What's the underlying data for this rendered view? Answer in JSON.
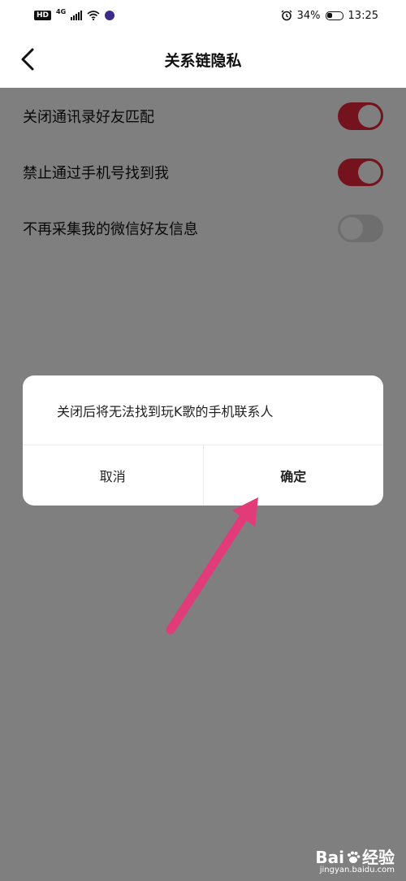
{
  "status_bar": {
    "hd": "HD",
    "network": "4G",
    "battery_pct": "34%",
    "time": "13:25",
    "icons": [
      "signal-icon",
      "wifi-icon",
      "app-icon",
      "alarm-icon",
      "battery-icon"
    ]
  },
  "nav": {
    "title": "关系链隐私",
    "back_icon": "chevron-left-icon"
  },
  "settings": [
    {
      "label": "关闭通讯录好友匹配",
      "enabled": true
    },
    {
      "label": "禁止通过手机号找到我",
      "enabled": true
    },
    {
      "label": "不再采集我的微信好友信息",
      "enabled": false
    }
  ],
  "dialog": {
    "message": "关闭后将无法找到玩K歌的手机联系人",
    "cancel_label": "取消",
    "confirm_label": "确定"
  },
  "annotation": {
    "arrow_color": "#e23b7a"
  },
  "watermark": {
    "brand": "Bai",
    "brand_tail": "经验",
    "url": "jingyan.baidu.com"
  },
  "colors": {
    "accent": "#e8263b",
    "overlay": "rgba(0,0,0,0.5)"
  }
}
